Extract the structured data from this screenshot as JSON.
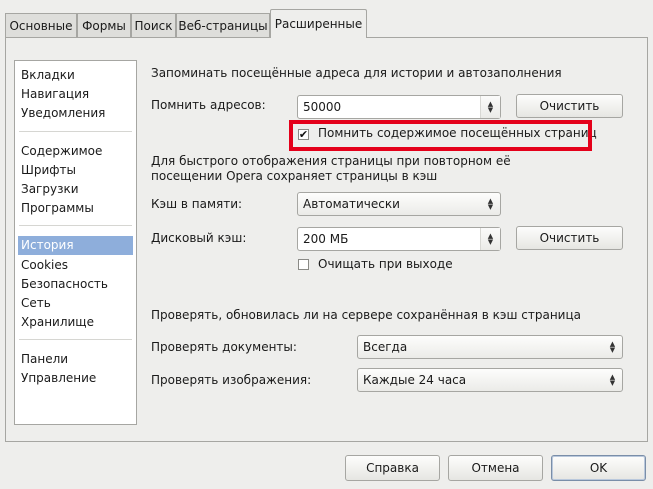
{
  "tabs": [
    {
      "label": "Основные",
      "active": false
    },
    {
      "label": "Формы",
      "active": false
    },
    {
      "label": "Поиск",
      "active": false
    },
    {
      "label": "Веб-страницы",
      "active": false
    },
    {
      "label": "Расширенные",
      "active": true
    }
  ],
  "sidebar": {
    "groups": [
      [
        "Вкладки",
        "Навигация",
        "Уведомления"
      ],
      [
        "Содержимое",
        "Шрифты",
        "Загрузки",
        "Программы"
      ],
      [
        "История",
        "Cookies",
        "Безопасность",
        "Сеть",
        "Хранилище"
      ],
      [
        "Панели",
        "Управление"
      ]
    ],
    "selected": "История"
  },
  "history": {
    "section_title": "Запоминать посещённые адреса для истории и автозаполнения",
    "remember_label": "Помнить адресов:",
    "remember_value": "50000",
    "clear_label": "Очистить",
    "remember_content_label": "Помнить содержимое посещённых страниц",
    "remember_content_checked": true
  },
  "cache": {
    "description_line1": "Для быстрого отображения страницы при повторном её",
    "description_line2": "посещении Opera сохраняет страницы в кэш",
    "memory_label": "Кэш в памяти:",
    "memory_value": "Автоматически",
    "disk_label": "Дисковый кэш:",
    "disk_value": "200 МБ",
    "clear_label": "Очистить",
    "clear_on_exit_label": "Очищать при выходе",
    "clear_on_exit_checked": false
  },
  "check": {
    "section_title": "Проверять, обновилась ли на сервере сохранённая в кэш страница",
    "documents_label": "Проверять документы:",
    "documents_value": "Всегда",
    "images_label": "Проверять изображения:",
    "images_value": "Каждые 24 часа"
  },
  "footer": {
    "help_label": "Справка",
    "cancel_label": "Отмена",
    "ok_label": "OK"
  },
  "colors": {
    "highlight": "#e4001a",
    "selection": "#8eaedb"
  }
}
